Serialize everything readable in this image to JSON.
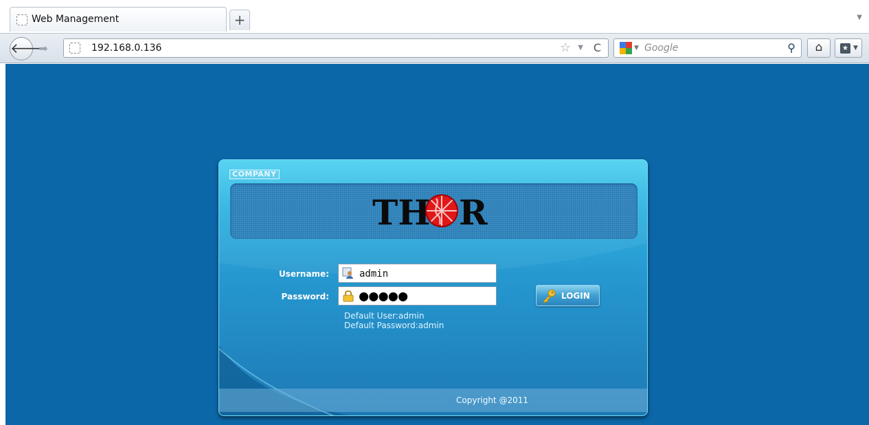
{
  "browser": {
    "tab_title": "Web Management",
    "new_tab_label": "+",
    "url": "192.168.0.136",
    "search_placeholder": "Google",
    "icons": {
      "back": "back-arrow-icon",
      "forward": "forward-arrow-icon",
      "bookmark_star": "star-icon",
      "reload": "reload-icon",
      "search": "magnifier-icon",
      "home": "home-icon",
      "bookmarks": "bookmarks-icon"
    }
  },
  "login": {
    "company_badge": "COMPANY",
    "logo_text_left": "TH",
    "logo_text_right": "R",
    "username_label": "Username:",
    "username_value": "admin",
    "password_label": "Password:",
    "password_mask": "●●●●●",
    "default_user_hint": "Default User:admin",
    "default_password_hint": "Default Password:admin",
    "login_button": "LOGIN",
    "copyright": "Copyright @2011"
  },
  "colors": {
    "page_background": "#0b67a8",
    "panel_top": "#4fd1f0",
    "panel_bottom": "#1d79b5",
    "logo_globe": "#e01818"
  }
}
